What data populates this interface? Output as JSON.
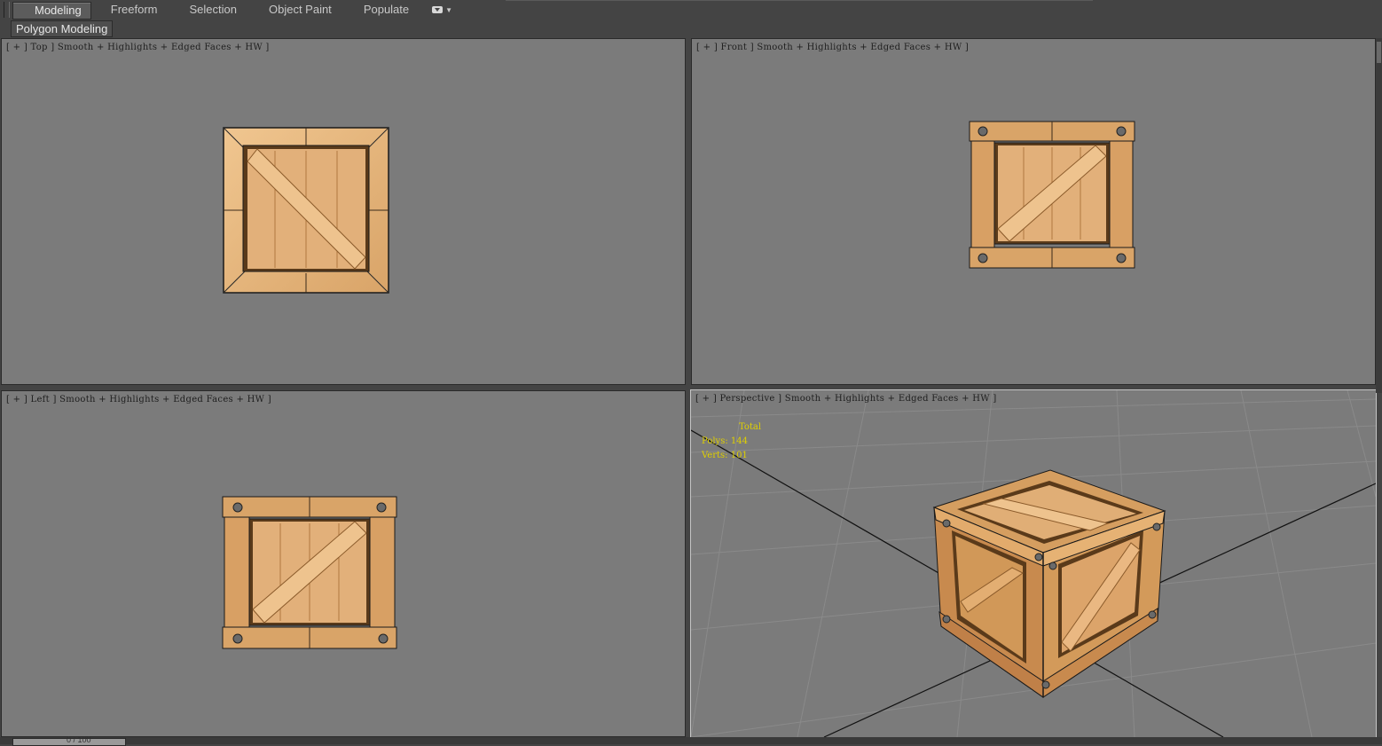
{
  "ribbon": {
    "tabs": [
      {
        "label": "Modeling",
        "active": true
      },
      {
        "label": "Freeform",
        "active": false
      },
      {
        "label": "Selection",
        "active": false
      },
      {
        "label": "Object Paint",
        "active": false
      },
      {
        "label": "Populate",
        "active": false
      }
    ],
    "options_icon": "ribbon-options-dropdown-icon"
  },
  "panel": {
    "label": "Polygon Modeling"
  },
  "viewports": {
    "top": {
      "label": "[ + ] Top ] Smooth + Highlights + Edged Faces + HW ]"
    },
    "front": {
      "label": "[ + ] Front ] Smooth + Highlights + Edged Faces + HW ]"
    },
    "left": {
      "label": "[ + ] Left ] Smooth + Highlights + Edged Faces + HW ]"
    },
    "perspective": {
      "label": "[ + ] Perspective ] Smooth + Highlights + Edged Faces + HW ]"
    }
  },
  "stats": {
    "total_label": "Total",
    "polys_label": "Polys:",
    "polys_value": "144",
    "verts_label": "Verts:",
    "verts_value": "101"
  },
  "timeline": {
    "frame": "0 / 100"
  },
  "colors": {
    "viewport_bg": "#7b7b7b",
    "wood_light": "#e6b47a",
    "wood_mid": "#d39c5e",
    "wood_dark": "#a86e3a",
    "edge": "#1a1a1a",
    "stats_text": "#e0d000"
  }
}
